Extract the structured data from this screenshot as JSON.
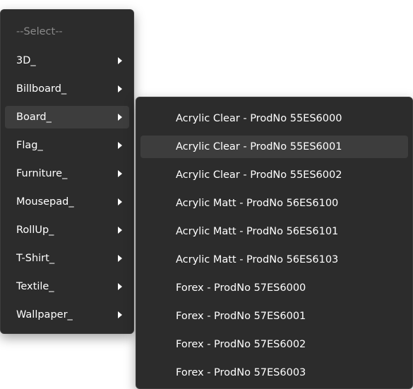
{
  "main_menu": {
    "placeholder": "--Select--",
    "items": [
      {
        "label": "3D_"
      },
      {
        "label": "Billboard_"
      },
      {
        "label": "Board_"
      },
      {
        "label": "Flag_"
      },
      {
        "label": "Furniture_"
      },
      {
        "label": "Mousepad_"
      },
      {
        "label": "RollUp_"
      },
      {
        "label": "T-Shirt_"
      },
      {
        "label": "Textile_"
      },
      {
        "label": "Wallpaper_"
      }
    ],
    "active_item": "Board_"
  },
  "sub_menu": {
    "items": [
      {
        "label": "Acrylic Clear - ProdNo 55ES6000"
      },
      {
        "label": "Acrylic Clear - ProdNo 55ES6001"
      },
      {
        "label": "Acrylic Clear - ProdNo 55ES6002"
      },
      {
        "label": "Acrylic Matt - ProdNo 56ES6100"
      },
      {
        "label": "Acrylic Matt - ProdNo 56ES6101"
      },
      {
        "label": "Acrylic Matt - ProdNo 56ES6103"
      },
      {
        "label": "Forex - ProdNo 57ES6000"
      },
      {
        "label": "Forex - ProdNo 57ES6001"
      },
      {
        "label": "Forex - ProdNo 57ES6002"
      },
      {
        "label": "Forex - ProdNo 57ES6003"
      }
    ],
    "hovered_item": "Acrylic Clear - ProdNo 55ES6001"
  },
  "colors": {
    "menu_background": "#2c2c2c",
    "hover_background": "#3d3d3d",
    "text": "#ffffff",
    "placeholder_text": "#8a8a8a"
  },
  "icons": {
    "submenu_arrow": "chevron-right-icon"
  }
}
